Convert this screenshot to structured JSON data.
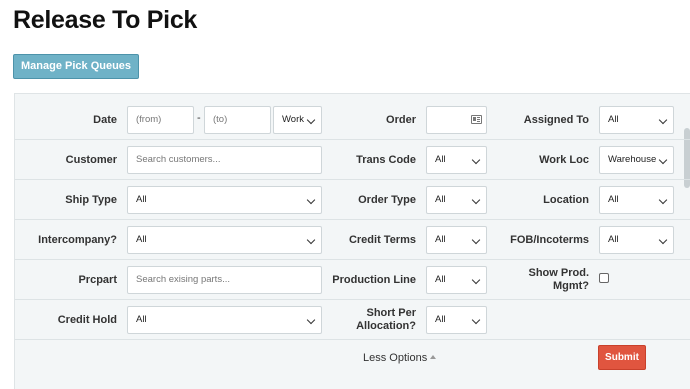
{
  "page_title": "Release To Pick",
  "manage_button": "Manage Pick Queues",
  "form": {
    "date": {
      "label": "Date",
      "from_placeholder": "(from)",
      "dash": "-",
      "to_placeholder": "(to)",
      "mode_value": "Work"
    },
    "order": {
      "label": "Order",
      "icon": "address-card-icon"
    },
    "assigned_to": {
      "label": "Assigned To",
      "value": "All"
    },
    "customer": {
      "label": "Customer",
      "placeholder": "Search customers..."
    },
    "trans_code": {
      "label": "Trans Code",
      "value": "All"
    },
    "work_loc": {
      "label": "Work Loc",
      "value": "Warehouse"
    },
    "ship_type": {
      "label": "Ship Type",
      "value": "All"
    },
    "order_type": {
      "label": "Order Type",
      "value": "All"
    },
    "location": {
      "label": "Location",
      "value": "All"
    },
    "intercompany": {
      "label": "Intercompany?",
      "value": "All"
    },
    "credit_terms": {
      "label": "Credit Terms",
      "value": "All"
    },
    "fob": {
      "label": "FOB/Incoterms",
      "value": "All"
    },
    "prcpart": {
      "label": "Prcpart",
      "placeholder": "Search exising parts..."
    },
    "production_line": {
      "label": "Production Line",
      "value": "All"
    },
    "show_prod": {
      "label_line1": "Show Prod.",
      "label_line2": "Mgmt?",
      "checked": false
    },
    "credit_hold": {
      "label": "Credit Hold",
      "value": "All"
    },
    "short_per_allocation": {
      "label_line1": "Short Per",
      "label_line2": "Allocation?",
      "value": "All"
    }
  },
  "less_options": "Less Options",
  "submit_button": "Submit",
  "colors": {
    "manage_button": "#6fb2c7",
    "submit_button": "#e0553f",
    "panel_bg": "#f3f6f7"
  }
}
